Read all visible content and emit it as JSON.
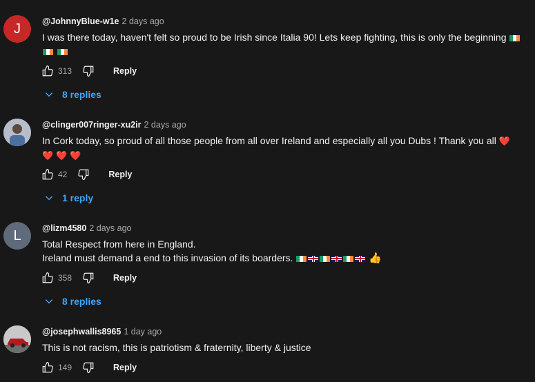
{
  "comments": [
    {
      "avatar_letter": "J",
      "avatar_color": "#c62828",
      "handle": "@JohnnyBlue-w1e",
      "time": "2 days ago",
      "text_line1": "I was there today, haven't felt so proud to be Irish since Italia 90! Lets keep fighting, this is only the beginning",
      "likes": "313",
      "reply_label": "Reply",
      "replies_label": "8 replies"
    },
    {
      "avatar_letter": "",
      "avatar_color": "#8a95a8",
      "handle": "@clinger007ringer-xu2ir",
      "time": "2 days ago",
      "text_line1": "In Cork today,  so proud of all those people from all over Ireland and especially all you Dubs ! Thank you all",
      "likes": "42",
      "reply_label": "Reply",
      "replies_label": "1 reply"
    },
    {
      "avatar_letter": "L",
      "avatar_color": "#5f6b7a",
      "handle": "@lizm4580",
      "time": "2 days ago",
      "text_line1": "Total Respect from here in England.",
      "text_line2": "Ireland must demand a end to this invasion of its boarders.",
      "likes": "358",
      "reply_label": "Reply",
      "replies_label": "8 replies"
    },
    {
      "avatar_letter": "",
      "avatar_color": "#9aa0a6",
      "handle": "@josephwallis8965",
      "time": "1 day ago",
      "text_line1": "This is not racism, this is patriotism & fraternity, liberty & justice",
      "likes": "149",
      "reply_label": "Reply"
    }
  ],
  "emoji": {
    "heart": "❤️",
    "thumbs_up": "👍"
  },
  "colors": {
    "background": "#181818",
    "text_primary": "#f1f1f1",
    "text_secondary": "#aaaaaa",
    "link_blue": "#3ea6ff"
  }
}
